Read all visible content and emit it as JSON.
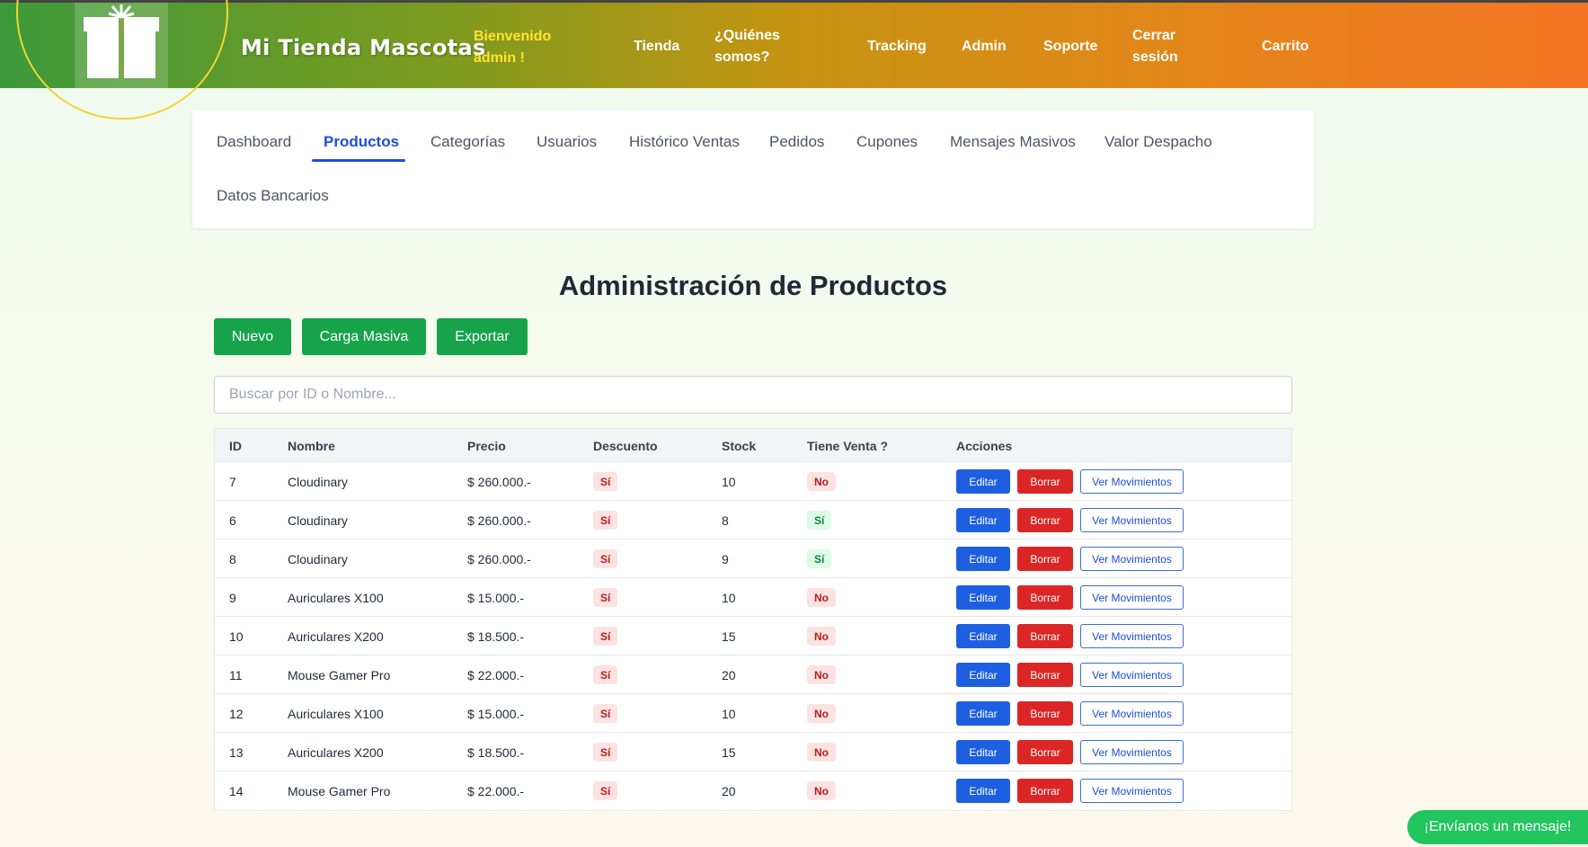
{
  "header": {
    "brand": "Mi Tienda Mascotas",
    "welcome": "Bienvenido admin !",
    "nav": {
      "tienda": "Tienda",
      "quienes": "¿Quiénes somos?",
      "tracking": "Tracking",
      "admin": "Admin",
      "soporte": "Soporte",
      "cerrar": "Cerrar sesión",
      "carrito": "Carrito"
    },
    "logo_icon": "gift-icon"
  },
  "tabs": {
    "dashboard": "Dashboard",
    "productos": "Productos",
    "categorias": "Categorías",
    "usuarios": "Usuarios",
    "historico": "Histórico Ventas",
    "pedidos": "Pedidos",
    "cupones": "Cupones",
    "mensajes": "Mensajes Masivos",
    "despacho": "Valor Despacho",
    "bancarios": "Datos Bancarios",
    "active": "Productos"
  },
  "page": {
    "title": "Administración de Productos",
    "btn_nuevo": "Nuevo",
    "btn_carga": "Carga Masiva",
    "btn_exportar": "Exportar",
    "search_placeholder": "Buscar por ID o Nombre..."
  },
  "table": {
    "columns": {
      "id": "ID",
      "nombre": "Nombre",
      "precio": "Precio",
      "descuento": "Descuento",
      "stock": "Stock",
      "venta": "Tiene Venta ?",
      "acciones": "Acciones"
    },
    "action_labels": {
      "edit": "Editar",
      "delete": "Borrar",
      "movements": "Ver Movimientos"
    },
    "rows": [
      {
        "id": "7",
        "nombre": "Cloudinary",
        "precio": "$ 260.000.-",
        "descuento": "Sí",
        "stock": "10",
        "venta": "No"
      },
      {
        "id": "6",
        "nombre": "Cloudinary",
        "precio": "$ 260.000.-",
        "descuento": "Sí",
        "stock": "8",
        "venta": "Sí"
      },
      {
        "id": "8",
        "nombre": "Cloudinary",
        "precio": "$ 260.000.-",
        "descuento": "Sí",
        "stock": "9",
        "venta": "Sí"
      },
      {
        "id": "9",
        "nombre": "Auriculares X100",
        "precio": "$ 15.000.-",
        "descuento": "Sí",
        "stock": "10",
        "venta": "No"
      },
      {
        "id": "10",
        "nombre": "Auriculares X200",
        "precio": "$ 18.500.-",
        "descuento": "Sí",
        "stock": "15",
        "venta": "No"
      },
      {
        "id": "11",
        "nombre": "Mouse Gamer Pro",
        "precio": "$ 22.000.-",
        "descuento": "Sí",
        "stock": "20",
        "venta": "No"
      },
      {
        "id": "12",
        "nombre": "Auriculares X100",
        "precio": "$ 15.000.-",
        "descuento": "Sí",
        "stock": "10",
        "venta": "No"
      },
      {
        "id": "13",
        "nombre": "Auriculares X200",
        "precio": "$ 18.500.-",
        "descuento": "Sí",
        "stock": "15",
        "venta": "No"
      },
      {
        "id": "14",
        "nombre": "Mouse Gamer Pro",
        "precio": "$ 22.000.-",
        "descuento": "Sí",
        "stock": "20",
        "venta": "No"
      }
    ]
  },
  "chat": {
    "label": "¡Envíanos un mensaje!"
  },
  "colors": {
    "accent_blue": "#1d4ed8",
    "green_button": "#16a34a",
    "danger": "#dc2626"
  }
}
